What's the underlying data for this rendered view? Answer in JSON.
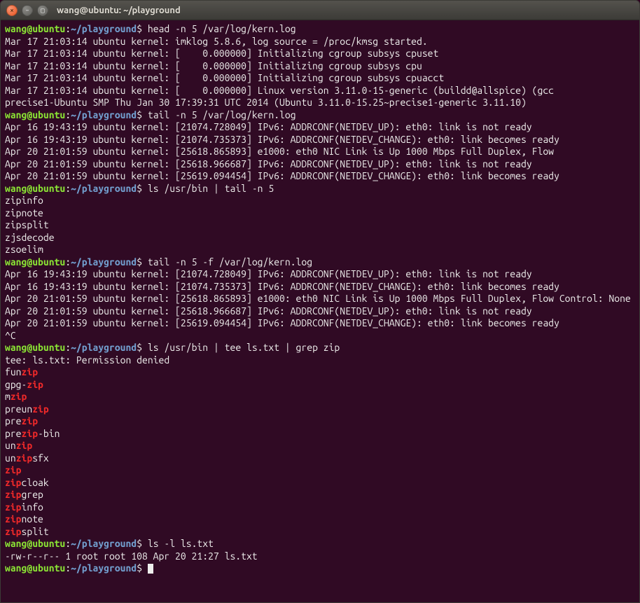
{
  "window": {
    "title": "wang@ubuntu: ~/playground",
    "controls": {
      "close": "×",
      "min": "–",
      "max": "▢"
    }
  },
  "prompt": {
    "user": "wang",
    "host": "ubuntu",
    "path": "~/playground",
    "symbol": "$"
  },
  "session": [
    {
      "type": "cmd",
      "text": "head -n 5 /var/log/kern.log"
    },
    {
      "type": "out",
      "text": "Mar 17 21:03:14 ubuntu kernel: imklog 5.8.6, log source = /proc/kmsg started."
    },
    {
      "type": "out",
      "text": "Mar 17 21:03:14 ubuntu kernel: [    0.000000] Initializing cgroup subsys cpuset"
    },
    {
      "type": "out",
      "text": "Mar 17 21:03:14 ubuntu kernel: [    0.000000] Initializing cgroup subsys cpu"
    },
    {
      "type": "out",
      "text": "Mar 17 21:03:14 ubuntu kernel: [    0.000000] Initializing cgroup subsys cpuacct"
    },
    {
      "type": "out",
      "text": "Mar 17 21:03:14 ubuntu kernel: [    0.000000] Linux version 3.11.0-15-generic (buildd@allspice) (gcc"
    },
    {
      "type": "out",
      "text": "precise1-Ubuntu SMP Thu Jan 30 17:39:31 UTC 2014 (Ubuntu 3.11.0-15.25~precise1-generic 3.11.10)"
    },
    {
      "type": "cmd",
      "text": "tail -n 5 /var/log/kern.log"
    },
    {
      "type": "out",
      "text": "Apr 16 19:43:19 ubuntu kernel: [21074.728049] IPv6: ADDRCONF(NETDEV_UP): eth0: link is not ready"
    },
    {
      "type": "out",
      "text": "Apr 16 19:43:19 ubuntu kernel: [21074.735373] IPv6: ADDRCONF(NETDEV_CHANGE): eth0: link becomes ready"
    },
    {
      "type": "out",
      "text": "Apr 20 21:01:59 ubuntu kernel: [25618.865893] e1000: eth0 NIC Link is Up 1000 Mbps Full Duplex, Flow"
    },
    {
      "type": "out",
      "text": "Apr 20 21:01:59 ubuntu kernel: [25618.966687] IPv6: ADDRCONF(NETDEV_UP): eth0: link is not ready"
    },
    {
      "type": "out",
      "text": "Apr 20 21:01:59 ubuntu kernel: [25619.094454] IPv6: ADDRCONF(NETDEV_CHANGE): eth0: link becomes ready"
    },
    {
      "type": "cmd",
      "text": "ls /usr/bin | tail -n 5"
    },
    {
      "type": "out",
      "text": "zipinfo"
    },
    {
      "type": "out",
      "text": "zipnote"
    },
    {
      "type": "out",
      "text": "zipsplit"
    },
    {
      "type": "out",
      "text": "zjsdecode"
    },
    {
      "type": "out",
      "text": "zsoelim"
    },
    {
      "type": "cmd",
      "text": "tail -n 5 -f /var/log/kern.log"
    },
    {
      "type": "out",
      "text": "Apr 16 19:43:19 ubuntu kernel: [21074.728049] IPv6: ADDRCONF(NETDEV_UP): eth0: link is not ready"
    },
    {
      "type": "out",
      "text": "Apr 16 19:43:19 ubuntu kernel: [21074.735373] IPv6: ADDRCONF(NETDEV_CHANGE): eth0: link becomes ready"
    },
    {
      "type": "out",
      "text": "Apr 20 21:01:59 ubuntu kernel: [25618.865893] e1000: eth0 NIC Link is Up 1000 Mbps Full Duplex, Flow Control: None"
    },
    {
      "type": "out",
      "text": "Apr 20 21:01:59 ubuntu kernel: [25618.966687] IPv6: ADDRCONF(NETDEV_UP): eth0: link is not ready"
    },
    {
      "type": "out",
      "text": "Apr 20 21:01:59 ubuntu kernel: [25619.094454] IPv6: ADDRCONF(NETDEV_CHANGE): eth0: link becomes ready"
    },
    {
      "type": "out",
      "text": "^C"
    },
    {
      "type": "cmd",
      "text": "ls /usr/bin | tee ls.txt | grep zip"
    },
    {
      "type": "out",
      "text": "tee: ls.txt: Permission denied"
    },
    {
      "type": "grep",
      "segments": [
        [
          "fun",
          false
        ],
        [
          "zip",
          true
        ]
      ]
    },
    {
      "type": "grep",
      "segments": [
        [
          "gpg-",
          false
        ],
        [
          "zip",
          true
        ]
      ]
    },
    {
      "type": "grep",
      "segments": [
        [
          "m",
          false
        ],
        [
          "zip",
          true
        ]
      ]
    },
    {
      "type": "grep",
      "segments": [
        [
          "preun",
          false
        ],
        [
          "zip",
          true
        ]
      ]
    },
    {
      "type": "grep",
      "segments": [
        [
          "pre",
          false
        ],
        [
          "zip",
          true
        ]
      ]
    },
    {
      "type": "grep",
      "segments": [
        [
          "pre",
          false
        ],
        [
          "zip",
          true
        ],
        [
          "-bin",
          false
        ]
      ]
    },
    {
      "type": "grep",
      "segments": [
        [
          "un",
          false
        ],
        [
          "zip",
          true
        ]
      ]
    },
    {
      "type": "grep",
      "segments": [
        [
          "un",
          false
        ],
        [
          "zip",
          true
        ],
        [
          "sfx",
          false
        ]
      ]
    },
    {
      "type": "grep",
      "segments": [
        [
          "zip",
          true
        ]
      ]
    },
    {
      "type": "grep",
      "segments": [
        [
          "zip",
          true
        ],
        [
          "cloak",
          false
        ]
      ]
    },
    {
      "type": "grep",
      "segments": [
        [
          "zip",
          true
        ],
        [
          "grep",
          false
        ]
      ]
    },
    {
      "type": "grep",
      "segments": [
        [
          "zip",
          true
        ],
        [
          "info",
          false
        ]
      ]
    },
    {
      "type": "grep",
      "segments": [
        [
          "zip",
          true
        ],
        [
          "note",
          false
        ]
      ]
    },
    {
      "type": "grep",
      "segments": [
        [
          "zip",
          true
        ],
        [
          "split",
          false
        ]
      ]
    },
    {
      "type": "cmd",
      "text": "ls -l ls.txt"
    },
    {
      "type": "out",
      "text": "-rw-r--r-- 1 root root 108 Apr 20 21:27 ls.txt"
    },
    {
      "type": "cmd",
      "text": "",
      "cursor": true
    }
  ]
}
